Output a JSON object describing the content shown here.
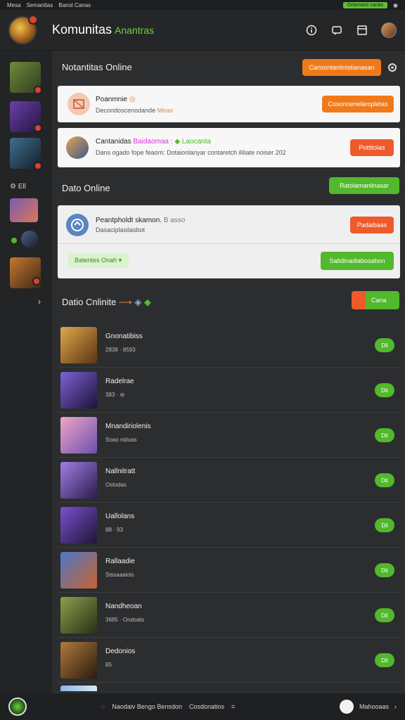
{
  "status": {
    "left": [
      "Mesa",
      "Semanitas",
      "Banol Canas"
    ],
    "right_pill": "Orlamano canas"
  },
  "header": {
    "title": "Komunitas",
    "title_accent": "Anantras"
  },
  "sections": {
    "notifications_online": {
      "title": "Notantitas Online",
      "button": "Carisontanlinistianasan"
    },
    "dato_online": {
      "title": "Dato Online",
      "button": "Ratolamanlinasar"
    },
    "datio_online": {
      "title": "Datio Cnlinite",
      "button": "Cana"
    }
  },
  "cards": [
    {
      "name": "Poanmnie",
      "sub": "Decondoscenodande",
      "sub_accent": "Meao",
      "button": "Cosonnenelaropletas"
    },
    {
      "name": "Cantanidas",
      "name_accent": "Baidaomaa :",
      "name_accent2": "Laocanta",
      "sub": "Dans ogado fope feaom: Dotaionlanyar contaretch ililiate noiser 202",
      "button": "Pottitolas"
    },
    {
      "name": "Peantpholdt skamon.",
      "name_suffix": "B asso",
      "sub": "Dasaciplasilasbot",
      "button": "Padaibaas",
      "badge": "Batentes Onah",
      "footer_button": "Saltdinadlabosabon"
    }
  ],
  "sidebar": {
    "mini_label": "Ell",
    "mini_icon": "gear-icon"
  },
  "rows": [
    {
      "name": "Gnonatibiss",
      "meta": "2838  ·  8593",
      "pill": "Dil"
    },
    {
      "name": "Radelrae",
      "meta": "383  ·  ⊖",
      "pill": "Dit"
    },
    {
      "name": "Mnandiriolenis",
      "meta": "Soao nidoas",
      "pill": "Dit"
    },
    {
      "name": "Nallnitratt",
      "meta": "Ostodas",
      "pill": "Dit"
    },
    {
      "name": "Uallolans",
      "meta": "88  ·  93",
      "pill": "Dil"
    },
    {
      "name": "Rallaadie",
      "meta": "Sissaaaiois",
      "pill": "Dit"
    },
    {
      "name": "Nandheoan",
      "meta": "3685  ·  Ondoats",
      "pill": "Dit"
    },
    {
      "name": "Dedonios",
      "meta": "85",
      "pill": "Dit"
    }
  ],
  "bottom": {
    "mid": "Naodaiv Bengo Bensdon",
    "mid2": "Cosdonatios",
    "right": "Mahooaas"
  },
  "colors": {
    "accent_green": "#52b82c",
    "accent_orange": "#f07a1a",
    "accent_red": "#ef5a2b",
    "background": "#2c2d2f"
  }
}
